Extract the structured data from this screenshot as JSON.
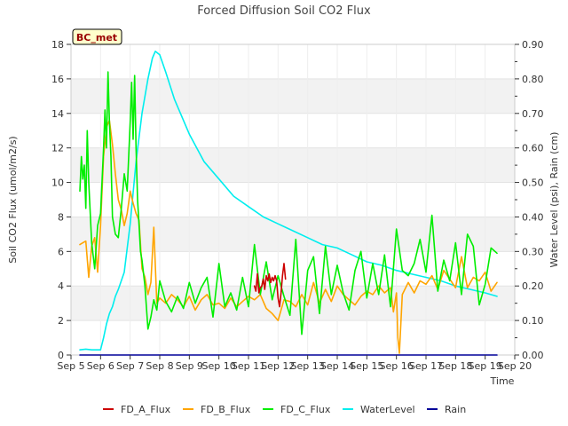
{
  "chart_data": {
    "type": "line",
    "title": "Forced Diffusion Soil CO2 Flux",
    "xlabel": "Time",
    "ylabel_left": "Soil CO2 Flux (umol/m2/s)",
    "ylabel_right": "Water Level (psi), Rain (cm)",
    "site_label": "BC_met",
    "ylim_left": [
      0,
      18
    ],
    "ylim_right": [
      0,
      0.9
    ],
    "xlim": [
      5,
      20
    ],
    "x_ticks": [
      {
        "v": 5,
        "label": "Sep 5"
      },
      {
        "v": 6,
        "label": "Sep 6"
      },
      {
        "v": 7,
        "label": "Sep 7"
      },
      {
        "v": 8,
        "label": "Sep 8"
      },
      {
        "v": 9,
        "label": "Sep 9"
      },
      {
        "v": 10,
        "label": "Sep 10"
      },
      {
        "v": 11,
        "label": "Sep 11"
      },
      {
        "v": 12,
        "label": "Sep 12"
      },
      {
        "v": 13,
        "label": "Sep 13"
      },
      {
        "v": 14,
        "label": "Sep 14"
      },
      {
        "v": 15,
        "label": "Sep 15"
      },
      {
        "v": 16,
        "label": "Sep 16"
      },
      {
        "v": 17,
        "label": "Sep 17"
      },
      {
        "v": 18,
        "label": "Sep 18"
      },
      {
        "v": 19,
        "label": "Sep 19"
      },
      {
        "v": 20,
        "label": "Sep 20"
      }
    ],
    "y_ticks_left": [
      "0",
      "2",
      "4",
      "6",
      "8",
      "10",
      "12",
      "14",
      "16",
      "18"
    ],
    "y_ticks_right": [
      "0.00",
      "0.10",
      "0.20",
      "0.30",
      "0.40",
      "0.50",
      "0.60",
      "0.70",
      "0.80",
      "0.90"
    ],
    "grid": true,
    "legend_position": "bottom",
    "series": [
      {
        "name": "FD_A_Flux",
        "axis": "left",
        "color": "#cc0000",
        "x": [
          11.2,
          11.25,
          11.3,
          11.35,
          11.4,
          11.45,
          11.5,
          11.55,
          11.6,
          11.65,
          11.7,
          11.75,
          11.8,
          11.85,
          11.9,
          11.95,
          12.0,
          12.05,
          12.1,
          12.15,
          12.2,
          12.25
        ],
        "y": [
          4.0,
          3.7,
          4.7,
          3.6,
          3.9,
          4.0,
          4.4,
          3.8,
          4.6,
          4.3,
          4.7,
          4.2,
          4.5,
          4.3,
          4.6,
          4.3,
          3.3,
          2.8,
          3.6,
          4.6,
          5.3,
          4.4
        ]
      },
      {
        "name": "FD_B_Flux",
        "axis": "left",
        "color": "#ffa500",
        "x": [
          5.3,
          5.4,
          5.5,
          5.6,
          5.7,
          5.8,
          5.9,
          6.0,
          6.1,
          6.2,
          6.3,
          6.4,
          6.5,
          6.6,
          6.7,
          6.8,
          6.9,
          7.0,
          7.1,
          7.2,
          7.3,
          7.4,
          7.5,
          7.6,
          7.7,
          7.8,
          7.9,
          8.0,
          8.2,
          8.4,
          8.6,
          8.8,
          9.0,
          9.2,
          9.4,
          9.6,
          9.8,
          10.0,
          10.2,
          10.4,
          10.6,
          10.8,
          11.0,
          11.2,
          11.4,
          11.6,
          11.8,
          12.0,
          12.2,
          12.4,
          12.6,
          12.8,
          13.0,
          13.2,
          13.4,
          13.6,
          13.8,
          14.0,
          14.2,
          14.4,
          14.6,
          14.8,
          15.0,
          15.2,
          15.4,
          15.6,
          15.8,
          15.9,
          16.0,
          16.05,
          16.1,
          16.2,
          16.4,
          16.6,
          16.8,
          17.0,
          17.2,
          17.4,
          17.6,
          17.8,
          18.0,
          18.2,
          18.4,
          18.6,
          18.8,
          19.0,
          19.2,
          19.4
        ],
        "y": [
          6.4,
          6.5,
          6.6,
          4.5,
          6.3,
          6.8,
          4.8,
          7.5,
          11.5,
          13.2,
          13.6,
          12.2,
          10.5,
          9.0,
          8.4,
          7.5,
          8.2,
          9.5,
          8.8,
          8.2,
          7.8,
          5.0,
          4.5,
          3.5,
          4.2,
          7.4,
          3.0,
          3.3,
          3.0,
          3.5,
          3.2,
          2.8,
          3.4,
          2.6,
          3.2,
          3.5,
          2.9,
          3.0,
          2.7,
          3.3,
          2.8,
          3.1,
          3.4,
          3.2,
          3.5,
          2.7,
          2.4,
          2.0,
          3.2,
          3.1,
          2.8,
          3.5,
          2.9,
          4.2,
          3.0,
          3.8,
          3.1,
          4.0,
          3.5,
          3.2,
          2.9,
          3.4,
          3.7,
          3.5,
          4.0,
          3.6,
          3.9,
          2.5,
          3.6,
          1.0,
          0.1,
          3.5,
          4.2,
          3.6,
          4.3,
          4.1,
          4.6,
          3.8,
          4.9,
          4.4,
          3.9,
          5.7,
          3.9,
          4.5,
          4.3,
          4.8,
          3.7,
          4.2
        ]
      },
      {
        "name": "FD_C_Flux",
        "axis": "left",
        "color": "#00ee00",
        "x": [
          5.3,
          5.35,
          5.4,
          5.45,
          5.5,
          5.55,
          5.6,
          5.7,
          5.8,
          5.9,
          6.0,
          6.1,
          6.15,
          6.2,
          6.25,
          6.3,
          6.35,
          6.4,
          6.5,
          6.6,
          6.7,
          6.8,
          6.9,
          7.0,
          7.05,
          7.1,
          7.15,
          7.2,
          7.25,
          7.3,
          7.35,
          7.4,
          7.5,
          7.6,
          7.7,
          7.8,
          7.9,
          8.0,
          8.2,
          8.4,
          8.6,
          8.8,
          9.0,
          9.2,
          9.4,
          9.6,
          9.8,
          10.0,
          10.2,
          10.4,
          10.6,
          10.8,
          11.0,
          11.2,
          11.4,
          11.6,
          11.8,
          12.0,
          12.2,
          12.4,
          12.6,
          12.8,
          13.0,
          13.2,
          13.4,
          13.6,
          13.8,
          14.0,
          14.2,
          14.4,
          14.6,
          14.8,
          15.0,
          15.2,
          15.4,
          15.6,
          15.8,
          16.0,
          16.2,
          16.4,
          16.6,
          16.8,
          17.0,
          17.2,
          17.4,
          17.6,
          17.8,
          18.0,
          18.2,
          18.4,
          18.6,
          18.8,
          19.0,
          19.2,
          19.4
        ],
        "y": [
          9.5,
          11.5,
          10.2,
          11.0,
          8.5,
          13.0,
          10.0,
          6.5,
          5.0,
          7.5,
          8.2,
          12.0,
          14.2,
          12.0,
          16.4,
          13.5,
          11.5,
          8.0,
          7.0,
          6.8,
          8.5,
          10.5,
          9.5,
          13.5,
          15.8,
          12.5,
          16.2,
          12.0,
          9.0,
          7.5,
          6.0,
          5.5,
          4.0,
          1.5,
          2.2,
          3.2,
          2.6,
          4.3,
          3.1,
          2.5,
          3.4,
          2.7,
          4.2,
          3.0,
          3.9,
          4.5,
          2.2,
          5.3,
          2.8,
          3.6,
          2.6,
          4.5,
          2.8,
          6.4,
          3.5,
          5.4,
          3.2,
          4.6,
          3.4,
          2.3,
          6.7,
          1.2,
          4.9,
          5.7,
          2.4,
          6.3,
          3.5,
          5.2,
          3.6,
          2.6,
          4.9,
          6.0,
          3.3,
          5.3,
          3.5,
          5.8,
          2.8,
          7.3,
          4.9,
          4.6,
          5.3,
          6.7,
          4.8,
          8.1,
          3.7,
          5.5,
          4.3,
          6.5,
          3.5,
          7.0,
          6.3,
          2.9,
          4.1,
          6.2,
          5.9
        ]
      },
      {
        "name": "WaterLevel",
        "axis": "right",
        "color": "#00eeee",
        "x": [
          5.3,
          5.5,
          5.7,
          6.0,
          6.1,
          6.2,
          6.3,
          6.4,
          6.5,
          6.6,
          6.8,
          7.0,
          7.2,
          7.4,
          7.6,
          7.75,
          7.85,
          8.0,
          8.2,
          8.5,
          9.0,
          9.5,
          10.0,
          10.5,
          11.0,
          11.5,
          12.0,
          12.5,
          13.0,
          13.5,
          14.0,
          14.5,
          15.0,
          15.5,
          16.0,
          16.5,
          17.0,
          17.5,
          18.0,
          18.5,
          19.0,
          19.4
        ],
        "y": [
          0.015,
          0.017,
          0.015,
          0.015,
          0.05,
          0.09,
          0.12,
          0.14,
          0.17,
          0.19,
          0.24,
          0.38,
          0.56,
          0.7,
          0.8,
          0.86,
          0.88,
          0.87,
          0.82,
          0.74,
          0.64,
          0.56,
          0.51,
          0.46,
          0.43,
          0.4,
          0.38,
          0.36,
          0.34,
          0.32,
          0.31,
          0.29,
          0.27,
          0.26,
          0.245,
          0.235,
          0.225,
          0.215,
          0.2,
          0.19,
          0.18,
          0.17
        ]
      },
      {
        "name": "Rain",
        "axis": "right",
        "color": "#000099",
        "x": [
          5.3,
          19.4
        ],
        "y": [
          0.0,
          0.0
        ]
      }
    ]
  }
}
